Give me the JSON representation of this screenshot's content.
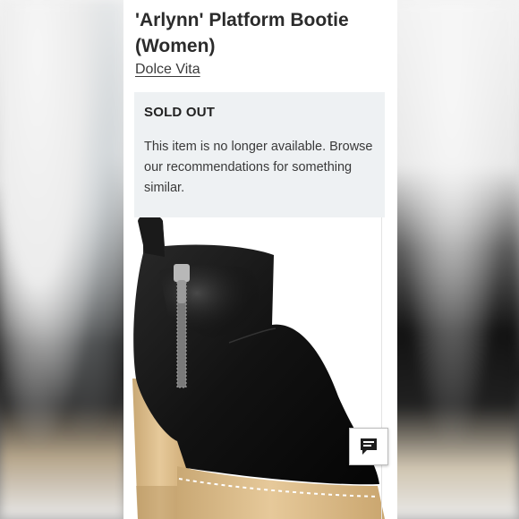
{
  "product": {
    "title": "'Arlynn' Platform Bootie (Women)",
    "brand": "Dolce Vita"
  },
  "availability": {
    "status": "SOLD OUT",
    "message": "This item is no longer available. Browse our recommendations for something similar."
  },
  "icons": {
    "chat": "chat-bubble-icon",
    "product_image": "black-leather-platform-bootie-image"
  },
  "colors": {
    "card_bg": "#ffffff",
    "notice_bg": "#eef1f3",
    "text": "#2b2b2b"
  }
}
